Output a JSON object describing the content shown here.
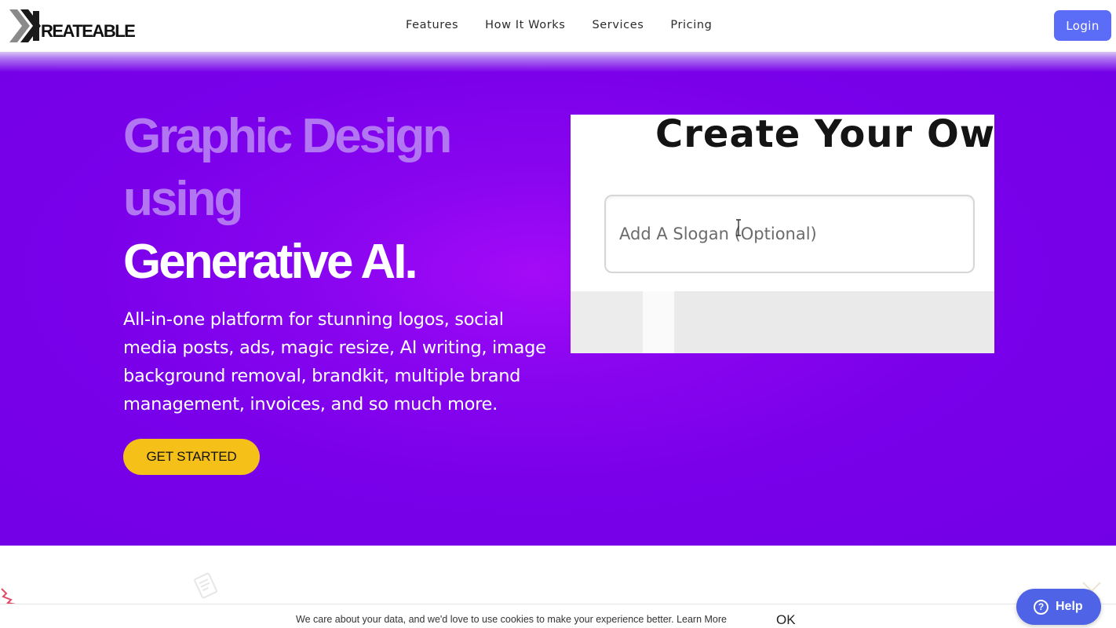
{
  "header": {
    "logo_text": "REATEABLE",
    "nav": [
      "Features",
      "How It Works",
      "Services",
      "Pricing"
    ],
    "login_label": "Login"
  },
  "hero": {
    "title_line1": "Graphic Design",
    "title_line2": "using",
    "title_line3": "Generative AI.",
    "description": "All-in-one platform for stunning logos, social media posts, ads, magic resize, AI writing, image background removal, brandkit, multiple brand management, invoices, and so much more.",
    "cta_label": "GET STARTED"
  },
  "demo": {
    "heading": "Create Your Ow",
    "slogan_placeholder": "Add A Slogan (Optional)"
  },
  "cookie": {
    "text": "We care about your data, and we'd love to use cookies to make your experience better. Learn More",
    "ok_label": "OK"
  },
  "help": {
    "label": "Help",
    "icon_glyph": "?"
  },
  "colors": {
    "hero_purple": "#7a00ea",
    "hero_glow": "#a40af7",
    "title_muted": "#b276f2",
    "cta_yellow": "#f5c018",
    "login_blue": "#5b6cf7",
    "help_blue": "#4f63e6"
  }
}
